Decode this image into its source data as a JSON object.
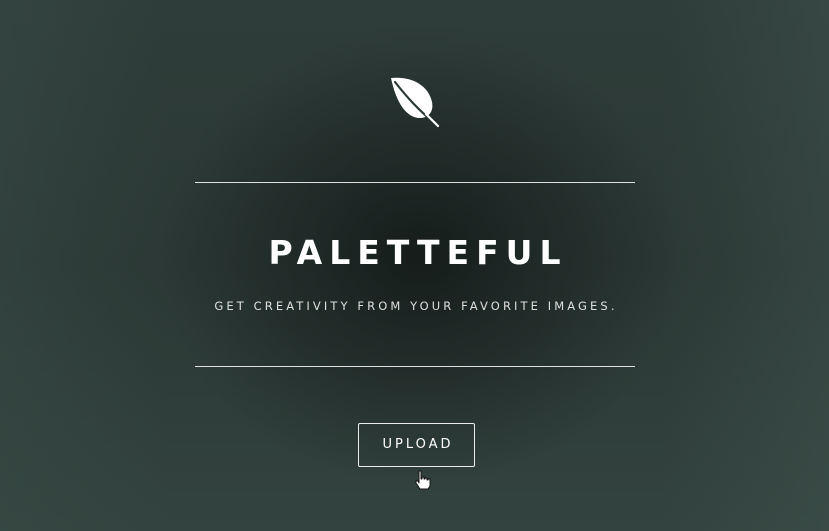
{
  "app": {
    "title": "PALETTEFUL",
    "tagline": "GET CREATIVITY FROM YOUR FAVORITE IMAGES.",
    "logo_icon": "leaf-icon"
  },
  "actions": {
    "upload_label": "UPLOAD"
  },
  "pointer": {
    "icon": "hand-pointer-icon"
  },
  "colors": {
    "background": "#2c3a36",
    "text": "#ffffff",
    "divider": "#ffffff"
  }
}
